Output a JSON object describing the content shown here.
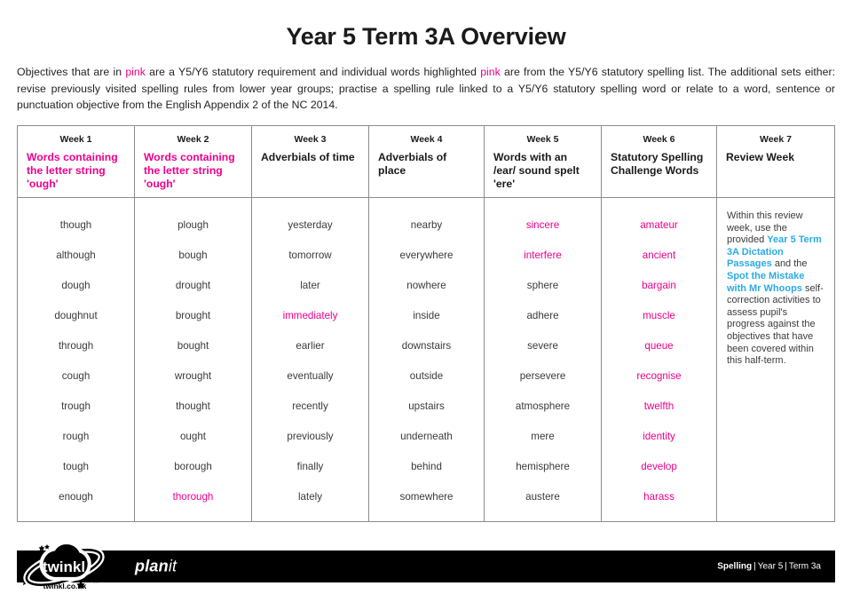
{
  "document": {
    "title": "Year 5 Term 3A Overview",
    "intro": {
      "part1": "Objectives that are in ",
      "pink1": "pink",
      "part2": " are a Y5/Y6 statutory requirement and individual words highlighted ",
      "pink2": "pink",
      "part3": " are from the Y5/Y6 statutory spelling list. The additional sets either: revise previously visited spelling rules from lower year groups; practise a spelling rule linked to a Y5/Y6 statutory spelling word or relate to a word, sentence or punctuation objective from the English Appendix 2 of the NC 2014."
    }
  },
  "colors": {
    "pink": "#ec008c",
    "cyan": "#29abe2",
    "text": "#231f20",
    "border": "#8c8c8c",
    "footer_bg": "#000000"
  },
  "table": {
    "columns": [
      {
        "week_label": "Week 1",
        "objective": "Words containing the letter string 'ough'",
        "objective_pink": true,
        "words": [
          {
            "text": "though",
            "pink": false
          },
          {
            "text": "although",
            "pink": false
          },
          {
            "text": "dough",
            "pink": false
          },
          {
            "text": "doughnut",
            "pink": false
          },
          {
            "text": "through",
            "pink": false
          },
          {
            "text": "cough",
            "pink": false
          },
          {
            "text": "trough",
            "pink": false
          },
          {
            "text": "rough",
            "pink": false
          },
          {
            "text": "tough",
            "pink": false
          },
          {
            "text": "enough",
            "pink": false
          }
        ]
      },
      {
        "week_label": "Week 2",
        "objective": "Words containing the letter string 'ough'",
        "objective_pink": true,
        "words": [
          {
            "text": "plough",
            "pink": false
          },
          {
            "text": "bough",
            "pink": false
          },
          {
            "text": "drought",
            "pink": false
          },
          {
            "text": "brought",
            "pink": false
          },
          {
            "text": "bought",
            "pink": false
          },
          {
            "text": "wrought",
            "pink": false
          },
          {
            "text": "thought",
            "pink": false
          },
          {
            "text": "ought",
            "pink": false
          },
          {
            "text": "borough",
            "pink": false
          },
          {
            "text": "thorough",
            "pink": true
          }
        ]
      },
      {
        "week_label": "Week 3",
        "objective": "Adverbials of time",
        "objective_pink": false,
        "words": [
          {
            "text": "yesterday",
            "pink": false
          },
          {
            "text": "tomorrow",
            "pink": false
          },
          {
            "text": "later",
            "pink": false
          },
          {
            "text": "immediately",
            "pink": true
          },
          {
            "text": "earlier",
            "pink": false
          },
          {
            "text": "eventually",
            "pink": false
          },
          {
            "text": "recently",
            "pink": false
          },
          {
            "text": "previously",
            "pink": false
          },
          {
            "text": "finally",
            "pink": false
          },
          {
            "text": "lately",
            "pink": false
          }
        ]
      },
      {
        "week_label": "Week 4",
        "objective": "Adverbials of place",
        "objective_pink": false,
        "words": [
          {
            "text": "nearby",
            "pink": false
          },
          {
            "text": "everywhere",
            "pink": false
          },
          {
            "text": "nowhere",
            "pink": false
          },
          {
            "text": "inside",
            "pink": false
          },
          {
            "text": "downstairs",
            "pink": false
          },
          {
            "text": "outside",
            "pink": false
          },
          {
            "text": "upstairs",
            "pink": false
          },
          {
            "text": "underneath",
            "pink": false
          },
          {
            "text": "behind",
            "pink": false
          },
          {
            "text": "somewhere",
            "pink": false
          }
        ]
      },
      {
        "week_label": "Week 5",
        "objective": "Words with an /ear/ sound spelt 'ere'",
        "objective_pink": false,
        "words": [
          {
            "text": "sincere",
            "pink": true
          },
          {
            "text": "interfere",
            "pink": true
          },
          {
            "text": "sphere",
            "pink": false
          },
          {
            "text": "adhere",
            "pink": false
          },
          {
            "text": "severe",
            "pink": false
          },
          {
            "text": "persevere",
            "pink": false
          },
          {
            "text": "atmosphere",
            "pink": false
          },
          {
            "text": "mere",
            "pink": false
          },
          {
            "text": "hemisphere",
            "pink": false
          },
          {
            "text": "austere",
            "pink": false
          }
        ]
      },
      {
        "week_label": "Week 6",
        "objective": "Statutory Spelling Challenge Words",
        "objective_pink": false,
        "words": [
          {
            "text": "amateur",
            "pink": true
          },
          {
            "text": "ancient",
            "pink": true
          },
          {
            "text": "bargain",
            "pink": true
          },
          {
            "text": "muscle",
            "pink": true
          },
          {
            "text": "queue",
            "pink": true
          },
          {
            "text": "recognise",
            "pink": true
          },
          {
            "text": "twelfth",
            "pink": true
          },
          {
            "text": "identity",
            "pink": true
          },
          {
            "text": "develop",
            "pink": true
          },
          {
            "text": "harass",
            "pink": true
          }
        ]
      },
      {
        "week_label": "Week 7",
        "objective": "Review Week",
        "objective_pink": false,
        "review": {
          "t1": "Within this review week, use the provided ",
          "link1": "Year 5 Term 3A Dictation Passages",
          "t2": " and the ",
          "link2": "Spot the Mistake with Mr Whoops",
          "t3": " self-correction activities to assess pupil's progress against the objectives that have been covered within this half-term."
        }
      }
    ]
  },
  "footer": {
    "brand": "twinkl",
    "brand_url": "twinkl.co.uk",
    "product_bold": "plan",
    "product_light": "it",
    "meta_subject": "Spelling",
    "meta_sep": "|",
    "meta_year": "Year 5",
    "meta_term": "Term 3a"
  }
}
